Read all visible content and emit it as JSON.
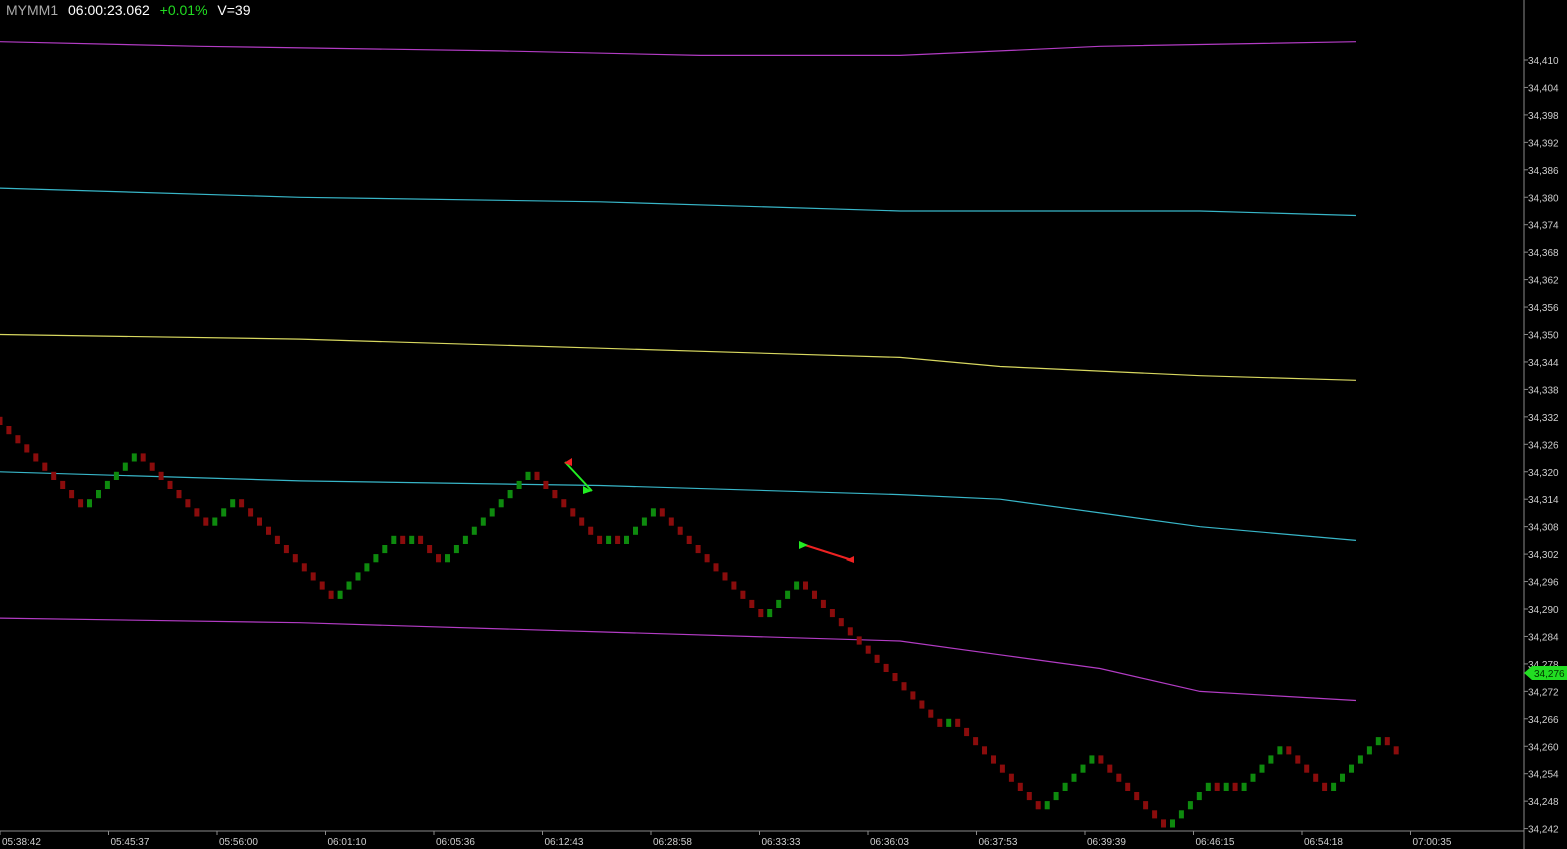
{
  "header": {
    "symbol": "MYMM1",
    "time": "06:00:23.062",
    "change": "+0.01%",
    "volume": "V=39"
  },
  "colors": {
    "up": "#0e8a0e",
    "down": "#8a0c0c",
    "magenta": "#b23cc4",
    "cyan": "#38b6c8",
    "yellow": "#d8d860",
    "price_label_bg": "#22dd22",
    "axis": "#8a8a8a"
  },
  "chart_data": {
    "type": "line",
    "chart_style": "renko",
    "y_axis": {
      "ticks": [
        "34,410",
        "34,404",
        "34,398",
        "34,392",
        "34,386",
        "34,380",
        "34,374",
        "34,368",
        "34,362",
        "34,356",
        "34,350",
        "34,344",
        "34,338",
        "34,332",
        "34,326",
        "34,320",
        "34,314",
        "34,308",
        "34,302",
        "34,296",
        "34,290",
        "34,284",
        "34,278",
        "34,272",
        "34,266",
        "34,260",
        "34,254",
        "34,248",
        "34,242"
      ],
      "range": [
        34240,
        34416
      ]
    },
    "x_axis": {
      "ticks": [
        "05:38:42",
        "05:45:37",
        "05:56:00",
        "06:01:10",
        "06:05:36",
        "06:12:43",
        "06:28:58",
        "06:33:33",
        "06:36:03",
        "06:37:53",
        "06:39:39",
        "06:46:15",
        "06:54:18",
        "07:00:35"
      ]
    },
    "last_price": "34,276",
    "series": [
      {
        "style": "magenta",
        "values": [
          [
            0,
            34414
          ],
          [
            200,
            34413
          ],
          [
            500,
            34412
          ],
          [
            700,
            34411
          ],
          [
            900,
            34411
          ],
          [
            1000,
            34412
          ],
          [
            1100,
            34413
          ],
          [
            1356,
            34414
          ]
        ]
      },
      {
        "style": "cyan",
        "values": [
          [
            0,
            34382
          ],
          [
            300,
            34380
          ],
          [
            600,
            34379
          ],
          [
            900,
            34377
          ],
          [
            1200,
            34377
          ],
          [
            1356,
            34376
          ]
        ]
      },
      {
        "style": "yellow",
        "values": [
          [
            0,
            34350
          ],
          [
            300,
            34349
          ],
          [
            600,
            34347
          ],
          [
            900,
            34345
          ],
          [
            1000,
            34343
          ],
          [
            1200,
            34341
          ],
          [
            1356,
            34340
          ]
        ]
      },
      {
        "style": "cyan",
        "values": [
          [
            0,
            34320
          ],
          [
            300,
            34318
          ],
          [
            600,
            34317
          ],
          [
            900,
            34315
          ],
          [
            1000,
            34314
          ],
          [
            1100,
            34311
          ],
          [
            1200,
            34308
          ],
          [
            1356,
            34305
          ]
        ]
      },
      {
        "style": "magenta",
        "values": [
          [
            0,
            34288
          ],
          [
            300,
            34287
          ],
          [
            600,
            34285
          ],
          [
            900,
            34283
          ],
          [
            1000,
            34280
          ],
          [
            1100,
            34277
          ],
          [
            1200,
            34272
          ],
          [
            1356,
            34270
          ]
        ]
      }
    ],
    "renko_bricks": [
      "d",
      "d",
      "d",
      "d",
      "d",
      "d",
      "d",
      "d",
      "d",
      "d",
      "u",
      "u",
      "u",
      "u",
      "u",
      "u",
      "d",
      "d",
      "d",
      "d",
      "d",
      "d",
      "d",
      "d",
      "u",
      "u",
      "u",
      "d",
      "d",
      "d",
      "d",
      "d",
      "d",
      "d",
      "d",
      "d",
      "d",
      "d",
      "u",
      "u",
      "u",
      "u",
      "u",
      "u",
      "u",
      "d",
      "u",
      "d",
      "d",
      "d",
      "u",
      "u",
      "u",
      "u",
      "u",
      "u",
      "u",
      "u",
      "u",
      "u",
      "d",
      "d",
      "d",
      "d",
      "d",
      "d",
      "d",
      "d",
      "u",
      "d",
      "u",
      "u",
      "u",
      "u",
      "d",
      "d",
      "d",
      "d",
      "d",
      "d",
      "d",
      "d",
      "d",
      "d",
      "d",
      "d",
      "u",
      "u",
      "u",
      "u",
      "d",
      "d",
      "d",
      "d",
      "d",
      "d",
      "d",
      "d",
      "d",
      "d",
      "d",
      "d",
      "d",
      "d",
      "d",
      "d",
      "u",
      "d",
      "d",
      "d",
      "d",
      "d",
      "d",
      "d",
      "d",
      "d",
      "d",
      "u",
      "u",
      "u",
      "u",
      "u",
      "u",
      "d",
      "d",
      "d",
      "d",
      "d",
      "d",
      "d",
      "d",
      "u",
      "u",
      "u",
      "u",
      "u",
      "d",
      "u",
      "d",
      "u",
      "u",
      "u",
      "u",
      "u",
      "d",
      "d",
      "d",
      "d",
      "d",
      "u",
      "u",
      "u",
      "u",
      "u",
      "u",
      "d",
      "d"
    ],
    "renko_start": 34332,
    "renko_box": 2
  }
}
